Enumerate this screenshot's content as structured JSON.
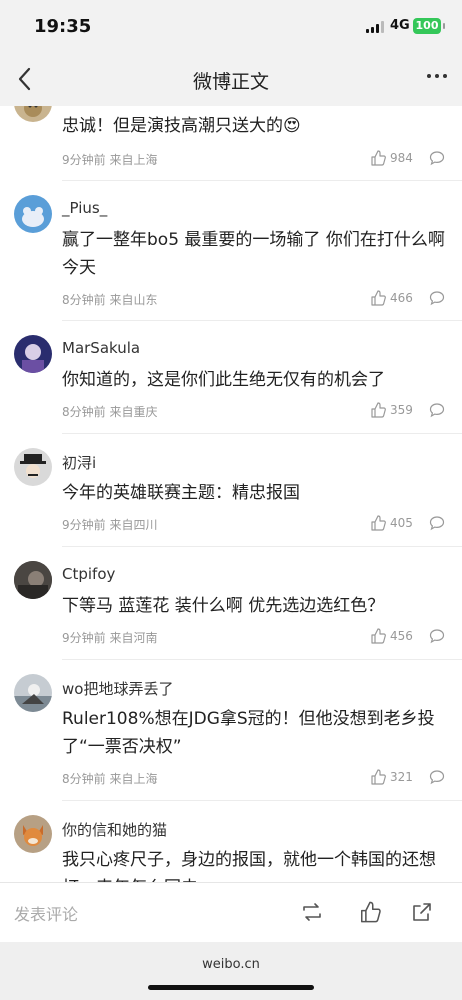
{
  "status": {
    "time": "19:35",
    "network": "4G",
    "battery": "100"
  },
  "nav": {
    "title": "微博正文"
  },
  "comments": [
    {
      "user": "",
      "text": "忠诚！但是演技高潮只送大的😍",
      "time": "9分钟前",
      "location": "来自上海",
      "likes": "984"
    },
    {
      "user": "_Pius_",
      "text": "赢了一整年bo5 最重要的一场输了 你们在打什么啊今天",
      "time": "8分钟前",
      "location": "来自山东",
      "likes": "466"
    },
    {
      "user": "MarSakula",
      "text": "你知道的，这是你们此生绝无仅有的机会了",
      "time": "8分钟前",
      "location": "来自重庆",
      "likes": "359"
    },
    {
      "user": "初浔i",
      "text": "今年的英雄联赛主题：精忠报国",
      "time": "9分钟前",
      "location": "来自四川",
      "likes": "405"
    },
    {
      "user": "Ctpifoy",
      "text": "下等马 蓝莲花 装什么啊 优先选边选红色？",
      "time": "9分钟前",
      "location": "来自河南",
      "likes": "456"
    },
    {
      "user": "wo把地球弄丢了",
      "text": "Ruler108%想在JDG拿S冠的！但他没想到老乡投了“一票否决权”",
      "time": "8分钟前",
      "location": "来自上海",
      "likes": "321"
    },
    {
      "user": "你的信和她的猫",
      "text": "我只心疼尺子，身边的报国，就他一个韩国的还想打，来年怎么回去",
      "time": "",
      "location": "",
      "likes": ""
    }
  ],
  "bottom": {
    "input_placeholder": "发表评论"
  },
  "browser": {
    "url": "weibo.cn"
  }
}
